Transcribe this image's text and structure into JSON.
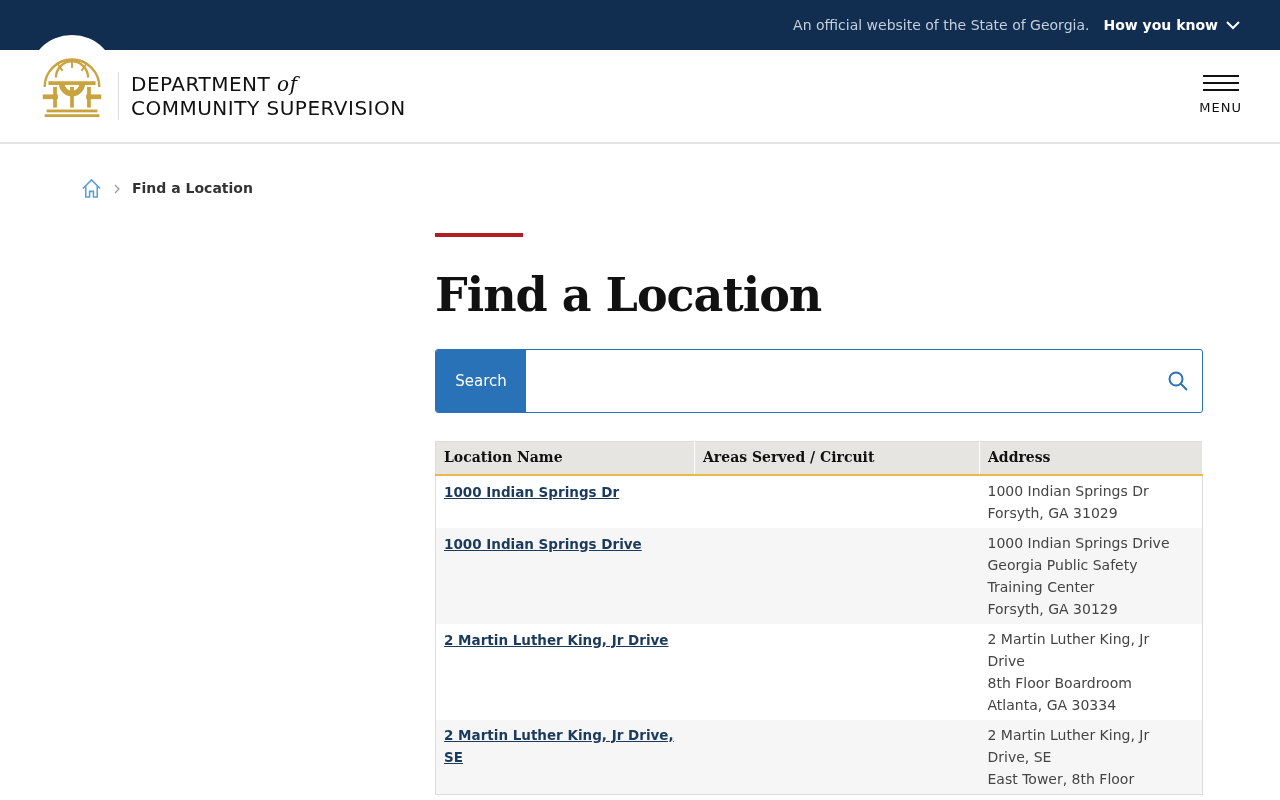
{
  "banner": {
    "notice": "An official website of the State of Georgia.",
    "toggle": "How you know"
  },
  "header": {
    "title_line_1": "DEPARTMENT",
    "title_connector": "of",
    "title_line_2": "COMMUNITY SUPERVISION",
    "menu": "MENU"
  },
  "breadcrumb": [
    {
      "label": "Find a Location"
    }
  ],
  "page_title": "Find a Location",
  "search": {
    "button": "Search"
  },
  "table": {
    "columns": [
      "Location Name",
      "Areas Served / Circuit",
      "Address"
    ],
    "rows": [
      {
        "name": "1000 Indian Springs Dr",
        "address": [
          "1000 Indian Springs Dr",
          "Forsyth, GA 31029"
        ]
      },
      {
        "name": "1000 Indian Springs Drive",
        "address": [
          "1000 Indian Springs Drive",
          "Georgia Public Safety",
          "Training Center",
          "Forsyth, GA 30129"
        ]
      },
      {
        "name": "2 Martin Luther King, Jr Drive",
        "address": [
          "2 Martin Luther King, Jr Drive",
          "8th Floor Boardroom",
          "Atlanta, GA 30334"
        ]
      },
      {
        "name": "2 Martin Luther King, Jr Drive, SE",
        "address": [
          "2 Martin Luther King, Jr Drive, SE",
          "East Tower, 8th Floor"
        ]
      }
    ]
  }
}
